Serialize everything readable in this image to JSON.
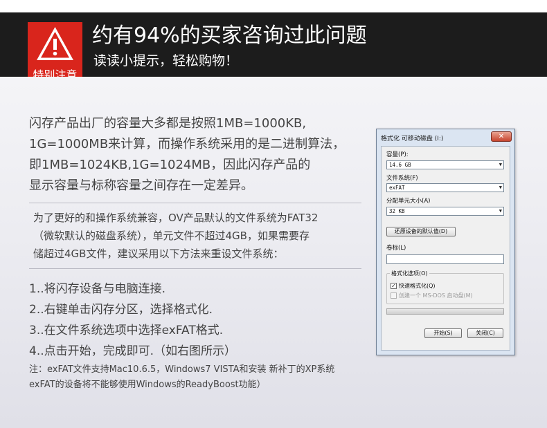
{
  "header": {
    "badge_label": "特别注意",
    "title": "约有94%的买家咨询过此问题",
    "subtitle": "读读小提示，轻松购物！"
  },
  "intro": [
    "闪存产品出厂的容量大多都是按照1MB=1000KB,",
    "1G=1000MB来计算，而操作系统采用的是二进制算法，",
    "即1MB=1024KB,1G=1024MB，因此闪存产品的",
    "显示容量与标称容量之间存在一定差异。"
  ],
  "advice": [
    "为了更好的和操作系统兼容，OV产品默认的文件系统为FAT32",
    "（微软默认的磁盘系统），单元文件不超过4GB，如果需要存",
    "储超过4GB文件，建议采用以下方法来重设文件系统："
  ],
  "steps": [
    "1..将闪存设备与电脑连接.",
    "2..右键单击闪存分区，选择格式化.",
    "3..在文件系统选项中选择exFAT格式.",
    "4..点击开始，完成即可.（如右图所示）"
  ],
  "note": [
    "注：exFAT文件支持Mac10.6.5，Windows7  VISTA和安装   新补丁的XP系统",
    "exFAT的设备将不能够使用Windows的ReadyBoost功能）"
  ],
  "dialog": {
    "title": "格式化 可移动磁盘 (I:)",
    "close_label": "✕",
    "capacity_label": "容量(P):",
    "capacity_value": "14.6 GB",
    "filesystem_label": "文件系统(F)",
    "filesystem_value": "exFAT",
    "allocation_label": "分配单元大小(A)",
    "allocation_value": "32 KB",
    "restore_button": "还原设备的默认值(D)",
    "volume_label": "卷标(L)",
    "volume_value": "",
    "options_label": "格式化选项(O)",
    "quick_format_label": "快速格式化(Q)",
    "msdos_label": "创建一个 MS-DOS 启动盘(M)",
    "start_button": "开始(S)",
    "close_button": "关闭(C)"
  },
  "colors": {
    "banner": "#1c1c1c",
    "badge": "#d9251c",
    "body_text": "#444444"
  }
}
